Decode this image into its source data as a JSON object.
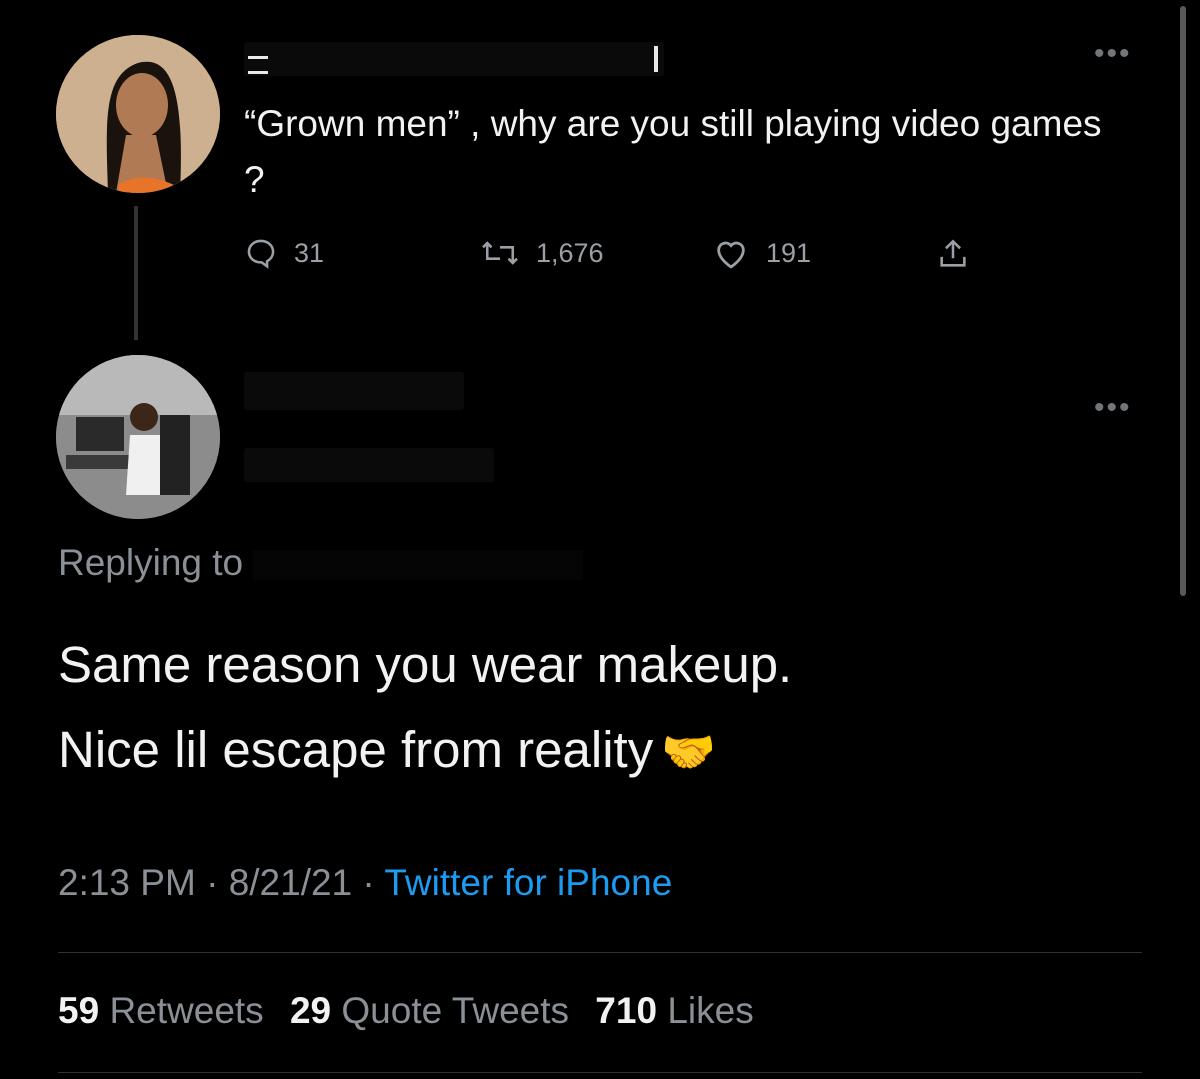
{
  "tweet": {
    "text": "“Grown men” , why are you still playing video games ?",
    "replies": "31",
    "retweets": "1,676",
    "likes": "191"
  },
  "reply": {
    "replying_to_label": "Replying to",
    "text_line1": "Same reason you wear makeup.",
    "text_line2": "Nice lil escape from reality",
    "emoji": "🤝",
    "time": "2:13 PM",
    "date": "8/21/21",
    "source": "Twitter for iPhone",
    "stats": {
      "retweets_count": "59",
      "retweets_label": "Retweets",
      "quotes_count": "29",
      "quotes_label": "Quote Tweets",
      "likes_count": "710",
      "likes_label": "Likes"
    }
  },
  "icons": {
    "more": "more-icon",
    "reply": "reply-icon",
    "retweet": "retweet-icon",
    "like": "heart-icon",
    "share": "share-icon"
  }
}
